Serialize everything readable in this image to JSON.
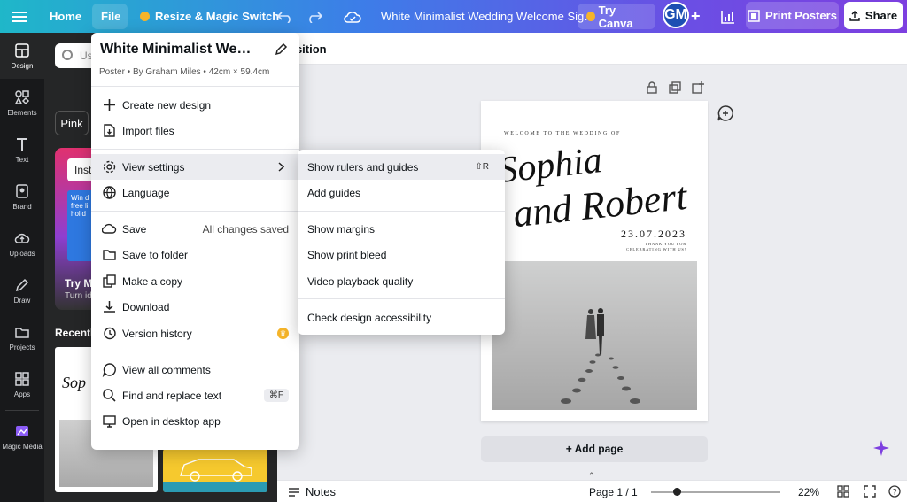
{
  "topbar": {
    "home": "Home",
    "file": "File",
    "resize": "Resize & Magic Switch",
    "doc_title": "White Minimalist Wedding Welcome Sig…",
    "try_canva": "Try Canva",
    "avatar": "GM",
    "print": "Print Posters",
    "share": "Share"
  },
  "rail": {
    "design": "Design",
    "elements": "Elements",
    "text": "Text",
    "brand": "Brand",
    "uploads": "Uploads",
    "draw": "Draw",
    "projects": "Projects",
    "apps": "Apps",
    "magic": "Magic Media"
  },
  "panel": {
    "search_placeholder": "Us",
    "chip": "Pink",
    "promo_label": "Inst",
    "promo_card": "Win d free li holid",
    "promo_title": "Try Ma",
    "promo_sub": "Turn id",
    "recent": "Recently"
  },
  "subtoolbar": {
    "position": "osition"
  },
  "file_menu": {
    "title": "White Minimalist Wedding …",
    "subtitle": "Poster • By Graham Miles • 42cm × 59.4cm",
    "create": "Create new design",
    "import": "Import files",
    "view_settings": "View settings",
    "language": "Language",
    "save": "Save",
    "saved_status": "All changes saved",
    "save_folder": "Save to folder",
    "copy": "Make a copy",
    "download": "Download",
    "version": "Version history",
    "comments": "View all comments",
    "find": "Find and replace text",
    "find_kbd": "⌘F",
    "desktop": "Open in desktop app"
  },
  "submenu": {
    "rulers": "Show rulers and guides",
    "rulers_kbd": "⇧R",
    "guides": "Add guides",
    "margins": "Show margins",
    "bleed": "Show print bleed",
    "video": "Video playback quality",
    "accessibility": "Check design accessibility"
  },
  "poster": {
    "welcome": "WELCOME TO THE WEDDING OF",
    "name1": "Sophia",
    "name2": "and Robert",
    "date": "23.07.2023",
    "thanks": "THANK YOU FOR CELEBRATING WITH US!"
  },
  "canvas": {
    "add_page": "+ Add page"
  },
  "bottombar": {
    "notes": "Notes",
    "page": "Page 1 / 1",
    "zoom": "22%"
  },
  "colors": {
    "accent": "#7d3fe0",
    "panel": "#252627",
    "rail": "#18191b"
  }
}
